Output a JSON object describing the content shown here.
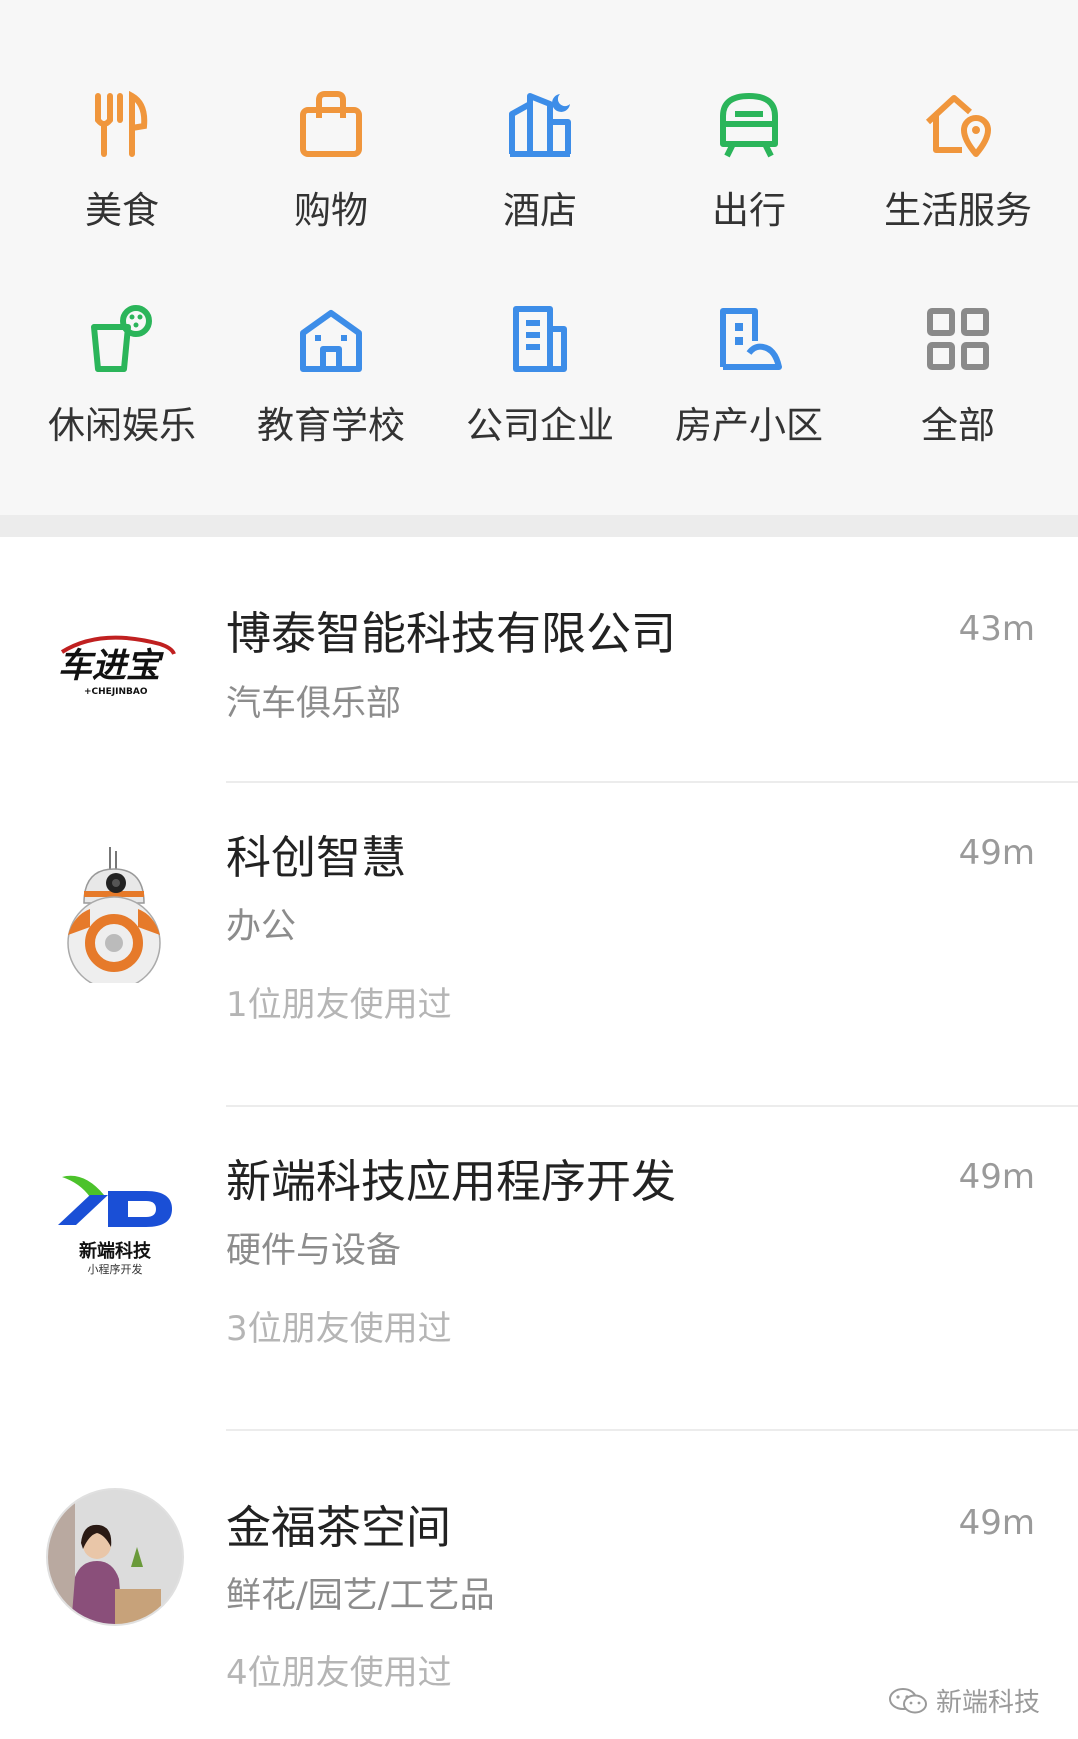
{
  "categories": [
    {
      "label": "美食",
      "icon": "food-utensils-icon",
      "color": "#f0963c"
    },
    {
      "label": "购物",
      "icon": "shopping-bag-icon",
      "color": "#f0963c"
    },
    {
      "label": "酒店",
      "icon": "hotel-building-icon",
      "color": "#3d8de8"
    },
    {
      "label": "出行",
      "icon": "transit-bus-icon",
      "color": "#2bb55a"
    },
    {
      "label": "生活服务",
      "icon": "home-location-icon",
      "color": "#f0963c"
    },
    {
      "label": "休闲娱乐",
      "icon": "drink-cup-icon",
      "color": "#2bb55a"
    },
    {
      "label": "教育学校",
      "icon": "school-building-icon",
      "color": "#3d8de8"
    },
    {
      "label": "公司企业",
      "icon": "office-building-icon",
      "color": "#3d8de8"
    },
    {
      "label": "房产小区",
      "icon": "residential-icon",
      "color": "#3d8de8"
    },
    {
      "label": "全部",
      "icon": "grid-all-icon",
      "color": "#8a8a8a"
    }
  ],
  "places": [
    {
      "name": "博泰智能科技有限公司",
      "category": "汽车俱乐部",
      "distance": "43m",
      "friends": "",
      "logo_text": "车进宝",
      "logo_sub": "+CHEJINBAO"
    },
    {
      "name": "科创智慧",
      "category": "办公",
      "distance": "49m",
      "friends": "1位朋友使用过"
    },
    {
      "name": "新端科技应用程序开发",
      "category": "硬件与设备",
      "distance": "49m",
      "friends": "3位朋友使用过",
      "logo_text": "新端科技",
      "logo_sub": "小程序开发"
    },
    {
      "name": "金福茶空间",
      "category": "鲜花/园艺/工艺品",
      "distance": "49m",
      "friends": "4位朋友使用过"
    }
  ],
  "watermark": "新端科技"
}
